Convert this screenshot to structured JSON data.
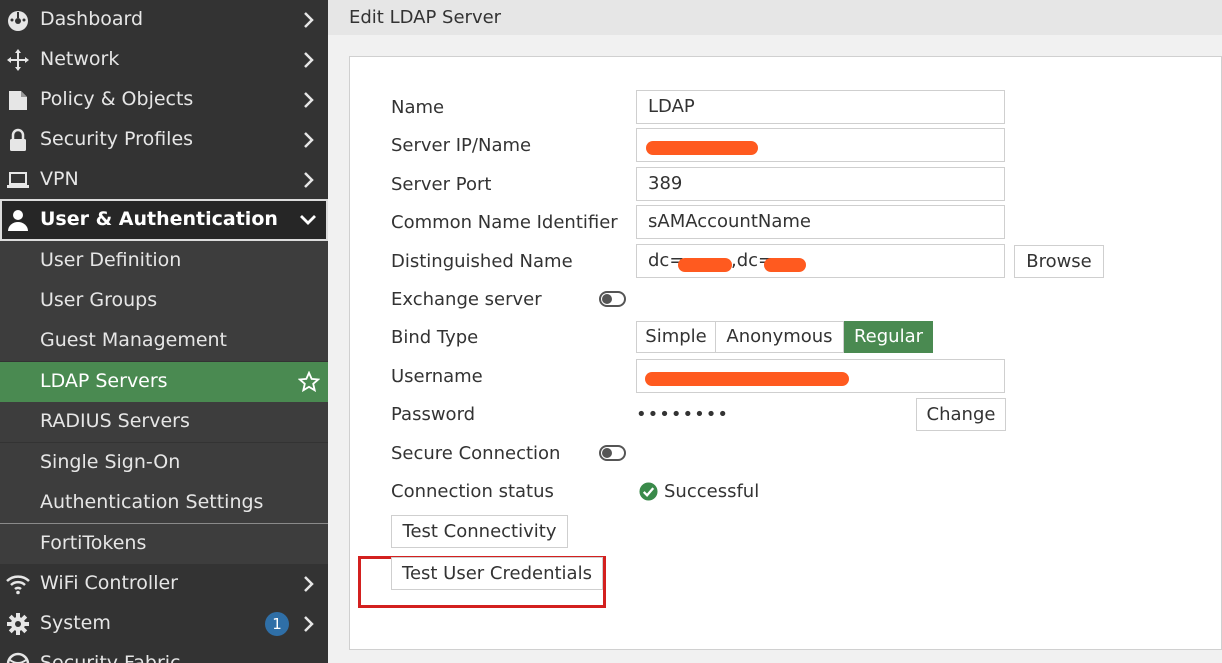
{
  "sidebar": {
    "items": [
      {
        "label": "Dashboard",
        "icon": "dashboard-icon"
      },
      {
        "label": "Network",
        "icon": "move-arrows-icon"
      },
      {
        "label": "Policy & Objects",
        "icon": "document-icon"
      },
      {
        "label": "Security Profiles",
        "icon": "lock-icon"
      },
      {
        "label": "VPN",
        "icon": "laptop-icon"
      }
    ],
    "active_section": {
      "label": "User & Authentication",
      "icon": "user-icon"
    },
    "sub_items": [
      {
        "label": "User Definition"
      },
      {
        "label": "User Groups"
      },
      {
        "label": "Guest Management"
      },
      {
        "label": "LDAP Servers",
        "active": true
      },
      {
        "label": "RADIUS Servers"
      },
      {
        "label": "Single Sign-On"
      },
      {
        "label": "Authentication Settings"
      },
      {
        "label": "FortiTokens"
      }
    ],
    "bottom_items": [
      {
        "label": "WiFi Controller",
        "icon": "wifi-icon"
      },
      {
        "label": "System",
        "icon": "gear-icon",
        "badge": "1"
      },
      {
        "label": "Security Fabric",
        "icon": "fabric-icon"
      }
    ]
  },
  "header": {
    "title": "Edit LDAP Server"
  },
  "form": {
    "name": {
      "label": "Name",
      "value": "LDAP"
    },
    "server_ip": {
      "label": "Server IP/Name",
      "value": ""
    },
    "server_port": {
      "label": "Server Port",
      "value": "389"
    },
    "cn_identifier": {
      "label": "Common Name Identifier",
      "value": "sAMAccountName"
    },
    "distinguished_name": {
      "label": "Distinguished Name",
      "value": "dc=",
      "value_mid": ",dc=",
      "browse_label": "Browse"
    },
    "exchange_server": {
      "label": "Exchange server",
      "enabled": false
    },
    "bind_type": {
      "label": "Bind Type",
      "options": [
        "Simple",
        "Anonymous",
        "Regular"
      ],
      "selected": "Regular"
    },
    "username": {
      "label": "Username",
      "value": ""
    },
    "password": {
      "label": "Password",
      "value": "••••••••",
      "change_label": "Change"
    },
    "secure_connection": {
      "label": "Secure Connection",
      "enabled": false
    },
    "connection_status": {
      "label": "Connection status",
      "value": "Successful"
    },
    "test_connectivity_label": "Test Connectivity",
    "test_user_credentials_label": "Test User Credentials"
  },
  "colors": {
    "sidebar_bg": "#333333",
    "active_green": "#4a8a51",
    "highlight_red": "#d3201f",
    "success_green": "#3a8a4a",
    "redaction_orange": "#ff5a1f"
  }
}
